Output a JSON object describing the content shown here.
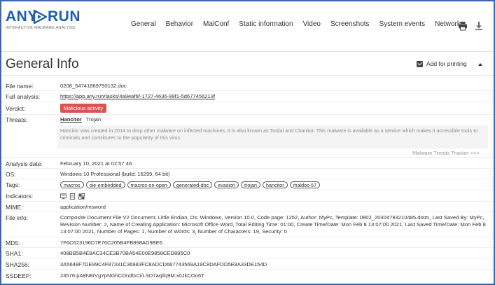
{
  "header": {
    "logo_any": "ANY",
    "logo_run": "RUN",
    "logo_sub": "INTERACTIVE MALWARE ANALYSIS",
    "nav": [
      "General",
      "Behavior",
      "MalConf",
      "Static information",
      "Video",
      "Screenshots",
      "System events",
      "Network"
    ]
  },
  "title_bar": {
    "title": "General Info",
    "add_for_printing": "Add for printing"
  },
  "info": {
    "file_name": {
      "label": "File name:",
      "value": "0208_54741869750132.doc"
    },
    "full_analysis": {
      "label": "Full analysis:",
      "value": "https://app.any.run/tasks/4a9eaf6f-1727-4636-99f1-5d677456213f"
    },
    "verdict": {
      "label": "Verdict:",
      "value": "Malicious activity"
    },
    "threats": {
      "label": "Threats:",
      "main": "Hancitor",
      "secondary": "Trojan",
      "description": "Hancitor was created in 2014 to drop other malware on infected machines. It is also known as Tordal and Chanitor. This malware is available as a service which makes it accessible tools to criminals and contributes to the popularity of this virus."
    },
    "malware_trends": "Malware Trends Tracker   >>>",
    "analysis_date": {
      "label": "Analysis date:",
      "value": "February 10, 2021 at 02:57:46"
    },
    "os": {
      "label": "OS:",
      "value": "Windows 10 Professional (build: 16299, 64 bit)"
    },
    "tags": {
      "label": "Tags:",
      "items": [
        "macros",
        "ole-embedded",
        "macros-on-open",
        "generated-doc",
        "evasion",
        "trojan",
        "hancitor",
        "maldoc-57"
      ]
    },
    "indicators": {
      "label": "Indicators:"
    },
    "mime": {
      "label": "MIME:",
      "value": "application/msword"
    },
    "file_info": {
      "label": "File info:",
      "value": "Composite Document File V2 Document, Little Endian, Os: Windows, Version 10.0, Code page: 1252, Author: MyPc, Template: 0802_20304783210485.dotm, Last Saved By: MyPc, Revision Number: 2, Name of Creating Application: Microsoft Office Word, Total Editing Time: 01:00, Create Time/Date: Mon Feb 8 13:07:00 2021, Last Saved Time/Date: Mon Feb 8 13:07:00 2021, Number of Pages: 1, Number of Words: 3, Number of Characters: 19, Security: 0"
    },
    "md5": {
      "label": "MD5:",
      "value": "7F6C623196D7E76C205B4FB898AD9BE6"
    },
    "sha1": {
      "label": "SHA1:",
      "value": "408BB5B4E8AC34CE3B70BA54E00E9858CED885C0"
    },
    "sha256": {
      "label": "SHA256:",
      "value": "3A5648F7DE99C4F87331C36983FC8ADCD667743569A19C8DAFDD5E8A33DE154D"
    },
    "ssdeep": {
      "label": "SSDEEP:",
      "value": "24576:pA8N8rVgYpNGhCOndGCi/LSD7aq/lq9M:x0JkCOo6T"
    }
  },
  "colors": {
    "brand": "#1f5fb0",
    "frame": "#3a66b3",
    "malicious": "#d9534f"
  },
  "icons": {
    "print": "printer-icon",
    "download": "download-icon",
    "collapse": "chevron-up-icon"
  }
}
